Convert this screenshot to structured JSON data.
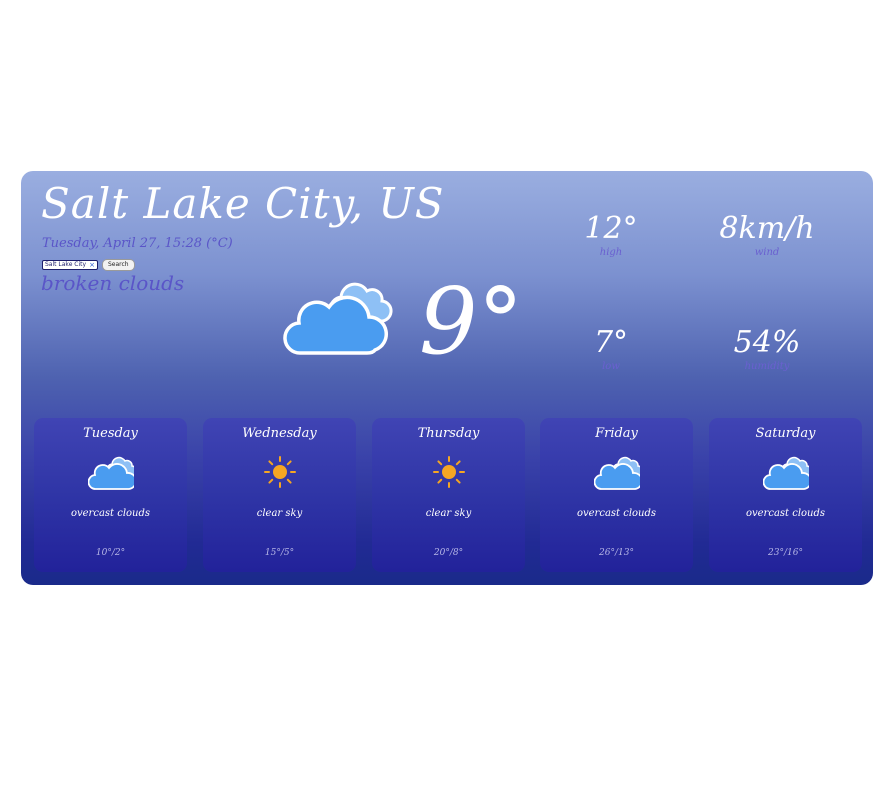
{
  "location": "Salt Lake City, US",
  "date_line": "Tuesday, April 27, 15:28 (°C)",
  "search": {
    "value": "Salt Lake City",
    "clear_icon": "×",
    "button_label": "Search"
  },
  "description": "broken clouds",
  "current": {
    "icon": "cloud-icon",
    "temperature": "9°"
  },
  "stats": {
    "high": {
      "value": "12°",
      "label": "high"
    },
    "wind": {
      "value": "8km/h",
      "label": "wind"
    },
    "low": {
      "value": "7°",
      "label": "low"
    },
    "humidity": {
      "value": "54%",
      "label": "humidity"
    }
  },
  "forecast": [
    {
      "day": "Tuesday",
      "icon": "cloud-icon",
      "desc": "overcast clouds",
      "range": "10°/2°"
    },
    {
      "day": "Wednesday",
      "icon": "sun-icon",
      "desc": "clear sky",
      "range": "15°/5°"
    },
    {
      "day": "Thursday",
      "icon": "sun-icon",
      "desc": "clear sky",
      "range": "20°/8°"
    },
    {
      "day": "Friday",
      "icon": "cloud-icon",
      "desc": "overcast clouds",
      "range": "26°/13°"
    },
    {
      "day": "Saturday",
      "icon": "cloud-icon",
      "desc": "overcast clouds",
      "range": "23°/16°"
    }
  ],
  "colors": {
    "accent_text": "#5a55c8",
    "cloud_fill": "#4a9cf0",
    "cloud_back": "#8ec0f5",
    "sun_fill": "#f5a623"
  }
}
